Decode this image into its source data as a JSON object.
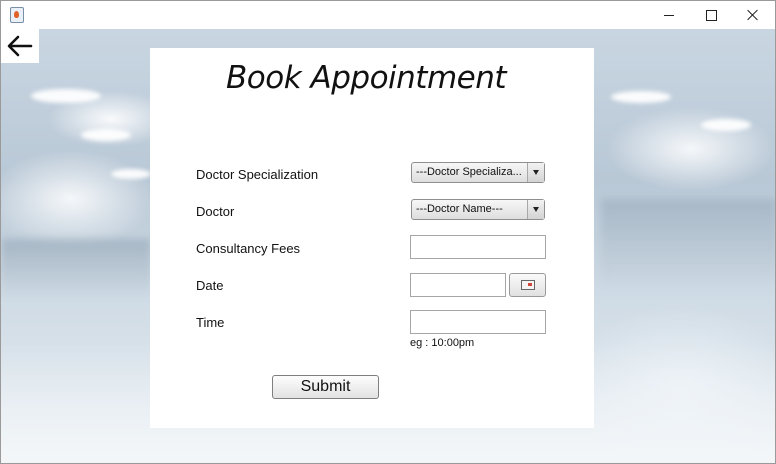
{
  "window": {
    "icon": "java-app-icon",
    "controls": [
      "minimize-icon",
      "maximize-icon",
      "close-icon"
    ]
  },
  "back_icon": "arrow-left-icon",
  "form": {
    "title": "Book Appointment",
    "fields": {
      "specialization": {
        "label": "Doctor Specialization",
        "selected": "---Doctor Specializa..."
      },
      "doctor": {
        "label": "Doctor",
        "selected": "---Doctor Name---"
      },
      "fees": {
        "label": "Consultancy Fees",
        "value": ""
      },
      "date": {
        "label": "Date",
        "value": "",
        "picker_icon": "calendar-icon"
      },
      "time": {
        "label": "Time",
        "value": "",
        "hint": "eg : 10:00pm"
      }
    },
    "submit_label": "Submit"
  },
  "colors": {
    "card_bg": "#ffffff",
    "backdrop": "#c9d6e2",
    "text": "#111111"
  }
}
